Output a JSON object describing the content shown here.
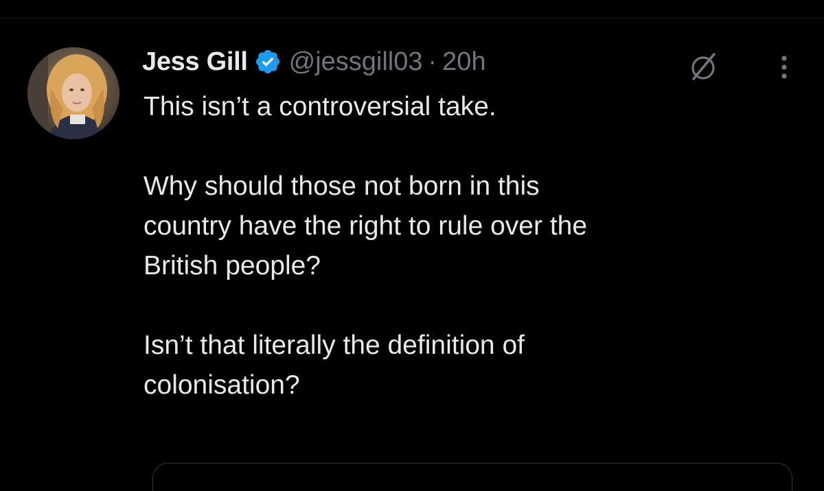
{
  "tweet": {
    "display_name": "Jess Gill",
    "handle": "@jessgill03",
    "separator": "·",
    "time": "20h",
    "body_lines": [
      "This isn’t a controversial take.",
      "",
      "Why should those not born in this",
      "country have the right to rule over the",
      "British people?",
      "",
      "Isn’t that literally the definition of",
      "colonisation?"
    ],
    "verified_icon": "verified-badge-icon",
    "grok_icon": "grok-icon",
    "more_icon": "more-options-icon"
  },
  "colors": {
    "background": "#000000",
    "primary_text": "#e7e9ea",
    "secondary_text": "#71767b",
    "verified_blue": "#1d9bf0",
    "border": "#2f3336"
  }
}
